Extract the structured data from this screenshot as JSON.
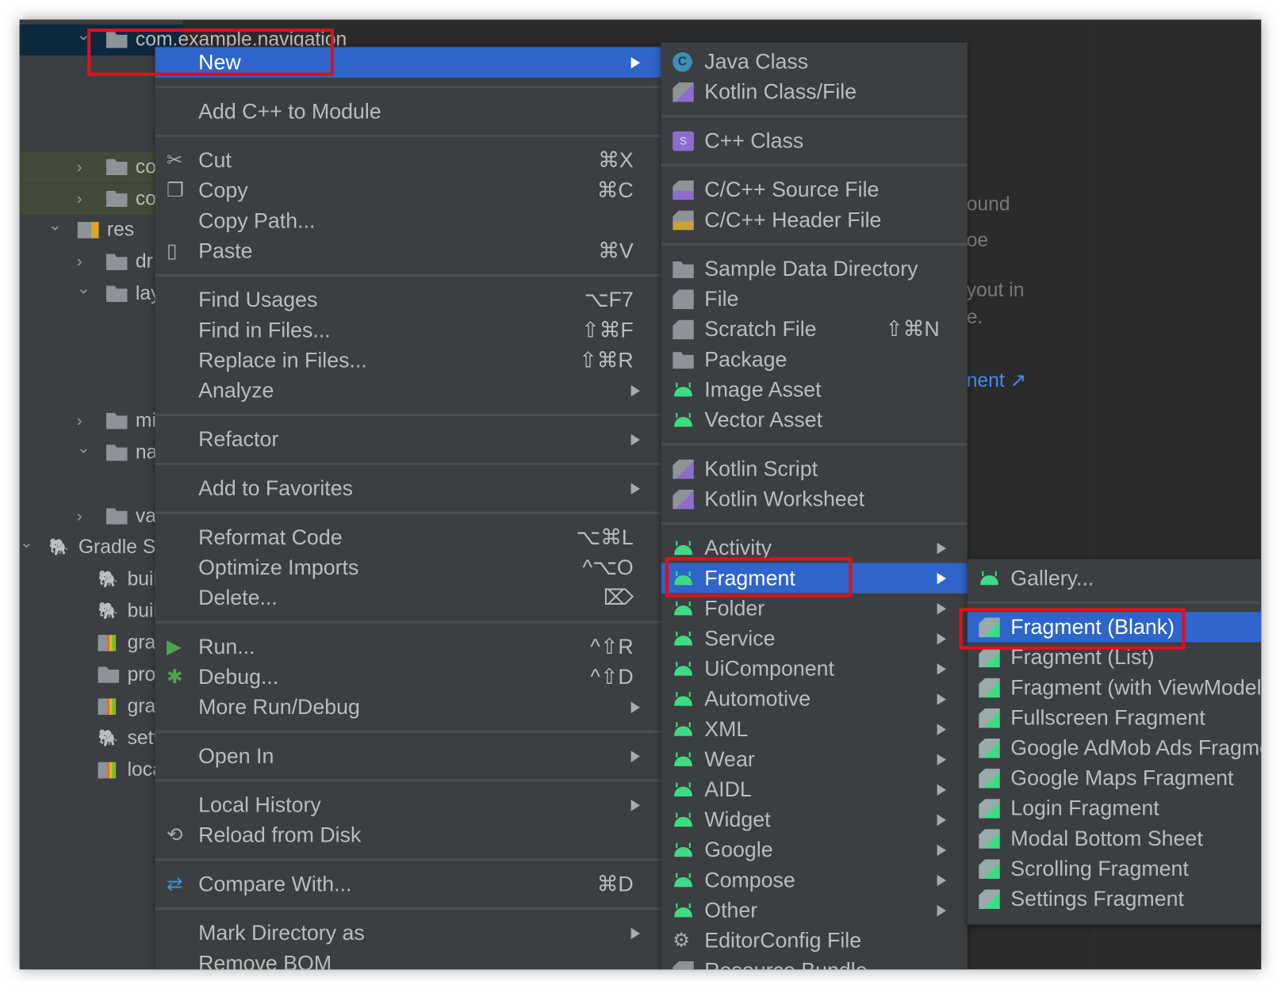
{
  "colors": {
    "highlight": "#2f65ca",
    "menu_bg": "#3c3f41",
    "annotation": "#e0101a",
    "android": "#3ddc84"
  },
  "project_tree": [
    {
      "label": "com.example.navigation",
      "icon": "package-folder-icon",
      "chevron": "down"
    },
    {
      "label": "",
      "icon": "class-icon"
    },
    {
      "label": "",
      "icon": "class-icon"
    },
    {
      "label": "",
      "icon": "class-icon"
    },
    {
      "label": "co",
      "icon": "package-folder-icon",
      "chevron": "right"
    },
    {
      "label": "co",
      "icon": "package-folder-icon",
      "chevron": "right"
    },
    {
      "label": "res",
      "icon": "res-folder-icon",
      "chevron": "down"
    },
    {
      "label": "dr",
      "icon": "folder-icon",
      "chevron": "right"
    },
    {
      "label": "lay",
      "icon": "folder-icon",
      "chevron": "down"
    },
    {
      "label": "",
      "icon": "xml-file-icon"
    },
    {
      "label": "",
      "icon": "xml-file-icon"
    },
    {
      "label": "",
      "icon": "xml-file-icon"
    },
    {
      "label": "mi",
      "icon": "folder-icon",
      "chevron": "right"
    },
    {
      "label": "na",
      "icon": "folder-icon",
      "chevron": "down"
    },
    {
      "label": "",
      "icon": "xml-file-icon"
    },
    {
      "label": "va",
      "icon": "folder-icon",
      "chevron": "right"
    },
    {
      "label": "Gradle S",
      "icon": "gradle-icon",
      "chevron": "down"
    },
    {
      "label": "build",
      "icon": "gradle-icon"
    },
    {
      "label": "build",
      "icon": "gradle-icon"
    },
    {
      "label": "gradl",
      "icon": "properties-icon"
    },
    {
      "label": "progu",
      "icon": "file-icon"
    },
    {
      "label": "gradl",
      "icon": "properties-icon"
    },
    {
      "label": "settir",
      "icon": "gradle-icon"
    },
    {
      "label": "local.",
      "icon": "properties-icon"
    }
  ],
  "editor_fragments": [
    "ound",
    "oe",
    "yout in",
    "e.",
    "nent ↗"
  ],
  "context_menu": [
    {
      "label": "New",
      "submenu": true,
      "highlighted": true
    },
    {
      "sep": true
    },
    {
      "label": "Add C++ to Module"
    },
    {
      "sep": true
    },
    {
      "label": "Cut",
      "shortcut": "⌘X",
      "icon": "scissors-icon"
    },
    {
      "label": "Copy",
      "shortcut": "⌘C",
      "icon": "copy-icon"
    },
    {
      "label": "Copy Path..."
    },
    {
      "label": "Paste",
      "shortcut": "⌘V",
      "icon": "clipboard-icon"
    },
    {
      "sep": true
    },
    {
      "label": "Find Usages",
      "shortcut": "⌥F7"
    },
    {
      "label": "Find in Files...",
      "shortcut": "⇧⌘F"
    },
    {
      "label": "Replace in Files...",
      "shortcut": "⇧⌘R"
    },
    {
      "label": "Analyze",
      "submenu": true
    },
    {
      "sep": true
    },
    {
      "label": "Refactor",
      "submenu": true
    },
    {
      "sep": true
    },
    {
      "label": "Add to Favorites",
      "submenu": true
    },
    {
      "sep": true
    },
    {
      "label": "Reformat Code",
      "shortcut": "⌥⌘L"
    },
    {
      "label": "Optimize Imports",
      "shortcut": "^⌥O"
    },
    {
      "label": "Delete...",
      "shortcut": "⌦"
    },
    {
      "sep": true
    },
    {
      "label": "Run...",
      "shortcut": "^⇧R",
      "icon": "run-icon"
    },
    {
      "label": "Debug...",
      "shortcut": "^⇧D",
      "icon": "debug-icon"
    },
    {
      "label": "More Run/Debug",
      "submenu": true
    },
    {
      "sep": true
    },
    {
      "label": "Open In",
      "submenu": true
    },
    {
      "sep": true
    },
    {
      "label": "Local History",
      "submenu": true
    },
    {
      "label": "Reload from Disk",
      "icon": "reload-icon"
    },
    {
      "sep": true
    },
    {
      "label": "Compare With...",
      "shortcut": "⌘D",
      "icon": "compare-icon"
    },
    {
      "sep": true
    },
    {
      "label": "Mark Directory as",
      "submenu": true
    },
    {
      "label": "Remove BOM"
    }
  ],
  "new_submenu": [
    {
      "label": "Java Class",
      "icon": "java-class-icon"
    },
    {
      "label": "Kotlin Class/File",
      "icon": "kotlin-file-icon"
    },
    {
      "sep": true
    },
    {
      "label": "C++ Class",
      "icon": "cpp-class-icon"
    },
    {
      "sep": true
    },
    {
      "label": "C/C++ Source File",
      "icon": "cpp-source-icon"
    },
    {
      "label": "C/C++ Header File",
      "icon": "cpp-header-icon"
    },
    {
      "sep": true
    },
    {
      "label": "Sample Data Directory",
      "icon": "folder-icon"
    },
    {
      "label": "File",
      "icon": "file-icon"
    },
    {
      "label": "Scratch File",
      "shortcut": "⇧⌘N",
      "icon": "scratch-file-icon"
    },
    {
      "label": "Package",
      "icon": "folder-icon"
    },
    {
      "label": "Image Asset",
      "icon": "android-icon"
    },
    {
      "label": "Vector Asset",
      "icon": "android-icon"
    },
    {
      "sep": true
    },
    {
      "label": "Kotlin Script",
      "icon": "kotlin-file-icon"
    },
    {
      "label": "Kotlin Worksheet",
      "icon": "kotlin-file-icon"
    },
    {
      "sep": true
    },
    {
      "label": "Activity",
      "icon": "android-icon",
      "submenu": true
    },
    {
      "label": "Fragment",
      "icon": "android-icon",
      "submenu": true,
      "highlighted": true
    },
    {
      "label": "Folder",
      "icon": "android-icon",
      "submenu": true
    },
    {
      "label": "Service",
      "icon": "android-icon",
      "submenu": true
    },
    {
      "label": "UiComponent",
      "icon": "android-icon",
      "submenu": true
    },
    {
      "label": "Automotive",
      "icon": "android-icon",
      "submenu": true
    },
    {
      "label": "XML",
      "icon": "android-icon",
      "submenu": true
    },
    {
      "label": "Wear",
      "icon": "android-icon",
      "submenu": true
    },
    {
      "label": "AIDL",
      "icon": "android-icon",
      "submenu": true
    },
    {
      "label": "Widget",
      "icon": "android-icon",
      "submenu": true
    },
    {
      "label": "Google",
      "icon": "android-icon",
      "submenu": true
    },
    {
      "label": "Compose",
      "icon": "android-icon",
      "submenu": true
    },
    {
      "label": "Other",
      "icon": "android-icon",
      "submenu": true
    },
    {
      "label": "EditorConfig File",
      "icon": "gear-icon"
    },
    {
      "label": "Resource Bundle",
      "icon": "resource-bundle-icon"
    }
  ],
  "fragment_submenu": [
    {
      "label": "Gallery...",
      "icon": "android-icon"
    },
    {
      "sep": true
    },
    {
      "label": "Fragment (Blank)",
      "icon": "fragment-template-icon",
      "highlighted": true
    },
    {
      "label": "Fragment (List)",
      "icon": "fragment-template-icon"
    },
    {
      "label": "Fragment (with ViewModel)",
      "icon": "fragment-template-icon"
    },
    {
      "label": "Fullscreen Fragment",
      "icon": "fragment-template-icon"
    },
    {
      "label": "Google AdMob Ads Fragment",
      "icon": "fragment-template-icon"
    },
    {
      "label": "Google Maps Fragment",
      "icon": "fragment-template-icon"
    },
    {
      "label": "Login Fragment",
      "icon": "fragment-template-icon"
    },
    {
      "label": "Modal Bottom Sheet",
      "icon": "fragment-template-icon"
    },
    {
      "label": "Scrolling Fragment",
      "icon": "fragment-template-icon"
    },
    {
      "label": "Settings Fragment",
      "icon": "fragment-template-icon"
    }
  ]
}
